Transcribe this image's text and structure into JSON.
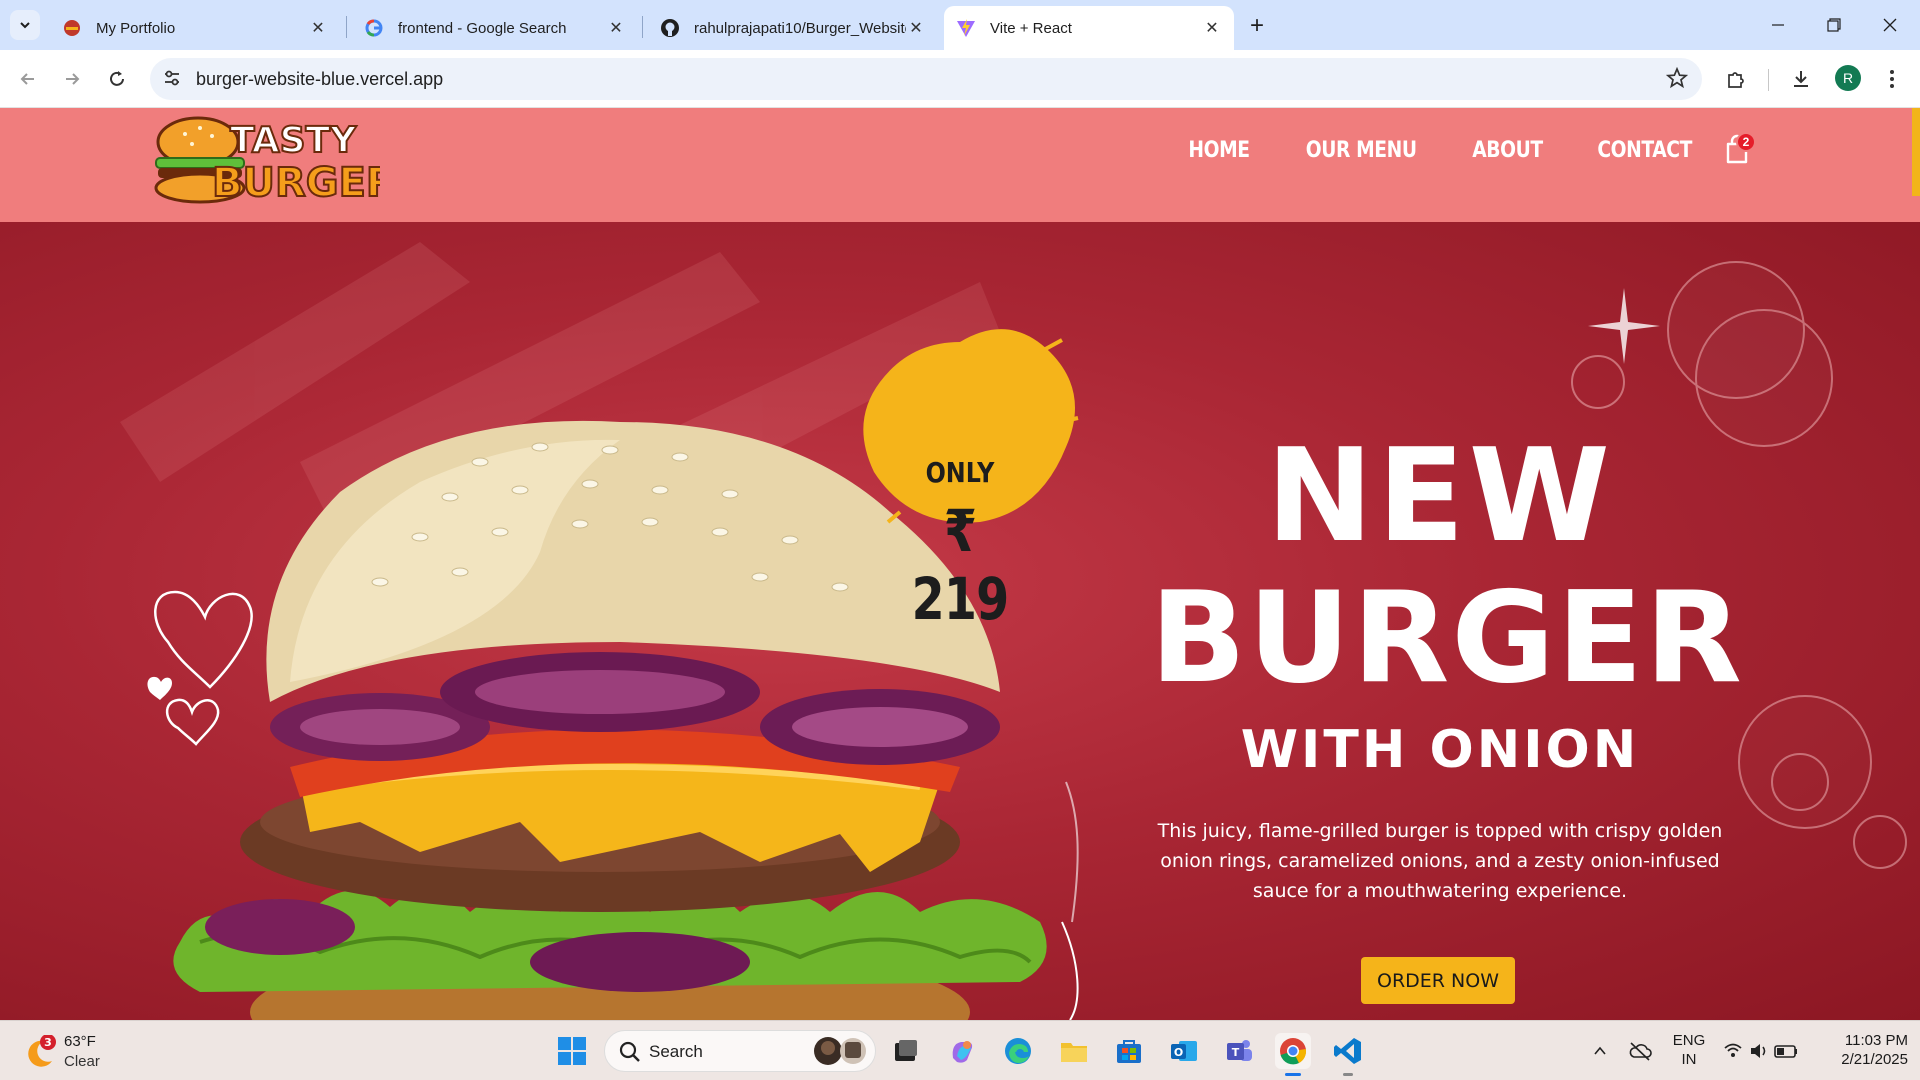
{
  "browser": {
    "tabs": [
      {
        "title": "My Portfolio",
        "icon": "portfolio-favicon"
      },
      {
        "title": "frontend - Google Search",
        "icon": "google-favicon"
      },
      {
        "title": "rahulprajapati10/Burger_Website",
        "icon": "github-favicon"
      },
      {
        "title": "Vite + React",
        "icon": "vite-favicon",
        "active": true
      }
    ],
    "url": "burger-website-blue.vercel.app",
    "profile_initial": "R"
  },
  "site": {
    "logo": {
      "line1": "TASTY",
      "line2": "BURGER"
    },
    "nav": [
      "HOME",
      "OUR MENU",
      "ABOUT",
      "CONTACT"
    ],
    "cart_count": "2",
    "accent_color": "#f07d7d",
    "brand_yellow": "#f5b41a"
  },
  "hero": {
    "price_prefix": "ONLY",
    "price": "₹ 219",
    "headline_1": "NEW",
    "headline_2": "BURGER",
    "subheadline": "WITH ONION",
    "description": "This juicy, flame-grilled burger is topped with crispy golden onion rings, caramelized onions, and a zesty onion-infused sauce for a mouthwatering experience.",
    "cta": "ORDER NOW"
  },
  "taskbar": {
    "weather": {
      "badge": "3",
      "temp": "63°F",
      "condition": "Clear"
    },
    "search_label": "Search",
    "lang_1": "ENG",
    "lang_2": "IN",
    "time": "11:03 PM",
    "date": "2/21/2025"
  }
}
